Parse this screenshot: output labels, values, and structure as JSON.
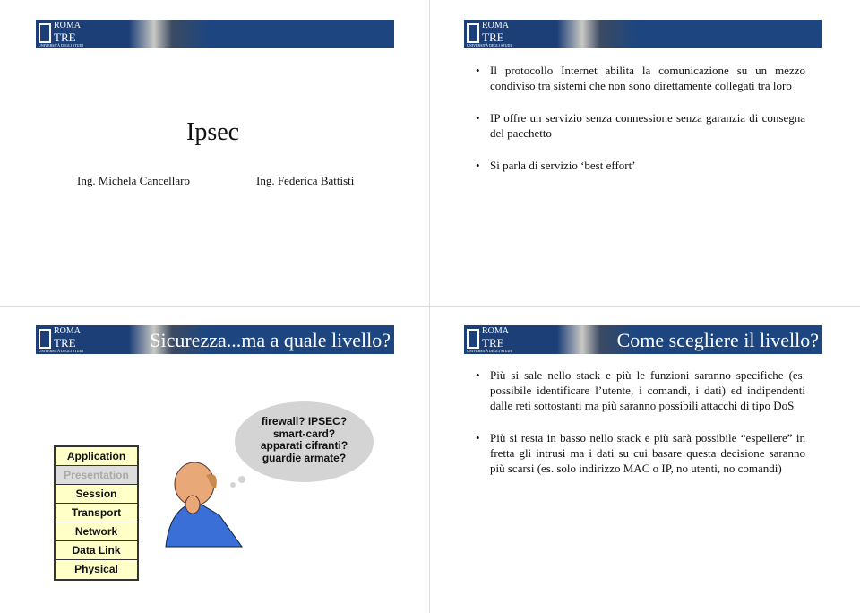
{
  "banner": {
    "logo_top": "ROMA",
    "logo_main": "TRE",
    "logo_sub": "UNIVERSITÀ DEGLI STUDI"
  },
  "slide1": {
    "title": "Ipsec",
    "author1": "Ing. Michela Cancellaro",
    "author2": "Ing. Federica Battisti"
  },
  "slide2": {
    "bullets": [
      "Il protocollo Internet abilita la comunicazione su un mezzo condiviso tra sistemi che non sono direttamente collegati tra loro",
      "IP offre un servizio senza connessione senza garanzia di consegna del pacchetto",
      "Si parla di servizio ‘best effort’"
    ]
  },
  "slide3": {
    "title": "Sicurezza...ma a quale livello?",
    "layers": [
      "Application",
      "Presentation",
      "Session",
      "Transport",
      "Network",
      "Data Link",
      "Physical"
    ],
    "thought": [
      "firewall? IPSEC?",
      "smart-card?",
      "apparati cifranti?",
      "guardie armate?"
    ]
  },
  "slide4": {
    "title": "Come scegliere il livello?",
    "bullets": [
      "Più si sale nello stack e più le funzioni saranno specifiche (es. possibile identificare l’utente, i comandi, i dati) ed indipendenti dalle reti sottostanti ma più saranno possibili attacchi di tipo DoS",
      "Più si resta in basso nello stack e più sarà possibile “espellere” in fretta gli intrusi ma i dati su cui basare questa decisione saranno più scarsi (es. solo indirizzo MAC o IP, no utenti, no comandi)"
    ]
  }
}
